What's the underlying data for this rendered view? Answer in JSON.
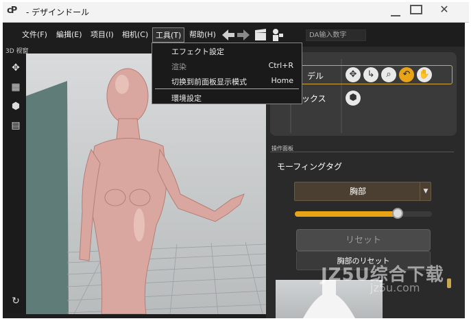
{
  "window": {
    "logo": "cP",
    "title": "- デザインドール",
    "buttons": {
      "minimize": "minimize",
      "maximize": "maximize",
      "close": "✕"
    }
  },
  "menubar": {
    "items": [
      "文件(F)",
      "編揖(E)",
      "项目(I)",
      "相机(C)",
      "工具(T)",
      "帮助(H)"
    ],
    "open_menu": "工具(T)",
    "tool_icons": [
      "arrow-left-icon",
      "arrow-right-icon",
      "clapperboard-icon",
      "figure-icon"
    ],
    "da_placeholder": "DA输入数字"
  },
  "tools_menu": {
    "items": [
      {
        "label": "エフェクト設定",
        "shortcut": ""
      },
      {
        "label": "渲染",
        "shortcut": "Ctrl+R"
      },
      {
        "label": "切换到前面板显示模式",
        "shortcut": "Home"
      },
      {
        "label": "環境設定",
        "shortcut": ""
      }
    ]
  },
  "viewport": {
    "label": "3D 视窗"
  },
  "left_toolbar": {
    "icons": [
      "camera-dolly-icon",
      "film-icon",
      "cube-icon",
      "grid-icon",
      "rotate-icon"
    ]
  },
  "mode_panel": {
    "model_label": "デル",
    "box_label": "ックス",
    "control_icons": [
      "move-icon",
      "rotate-handle-icon",
      "zoom-icon",
      "undo-icon",
      "hand-icon"
    ],
    "box_icon": "cube-icon"
  },
  "operation_panel": {
    "label": "操作面板",
    "morph_label": "モーフィングタグ",
    "morph_selected": "胸部",
    "slider_fraction": 0.76,
    "reset_button": "リセット",
    "reset_part_button": "胸部のリセット"
  },
  "watermark": {
    "main": "JZ5U综合下载",
    "sub": "jz5u.com"
  },
  "colors": {
    "accent": "#e8a317",
    "highlight_border": "#d7a93a",
    "skin": "#d9a79f"
  }
}
